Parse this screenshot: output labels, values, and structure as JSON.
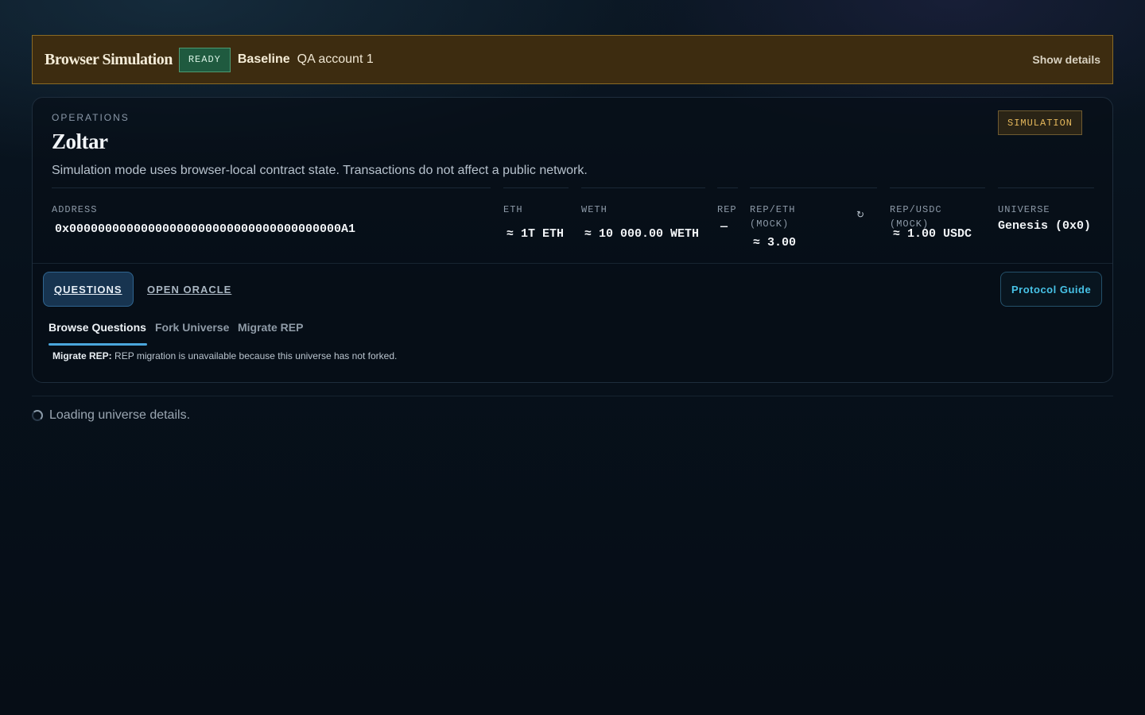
{
  "simulation_banner": {
    "title": "Browser Simulation",
    "status_badge": "READY",
    "scenario": "Baseline",
    "account": "QA account 1",
    "details_link": "Show details"
  },
  "header": {
    "eyebrow": "OPERATIONS",
    "title": "Zoltar",
    "mode_tag": "SIMULATION",
    "subtitle": "Simulation mode uses browser-local contract state. Transactions do not affect a public network."
  },
  "stats": {
    "address": {
      "label": "ADDRESS",
      "value": "0x00000000000000000000000000000000000000A1"
    },
    "eth": {
      "label": "ETH",
      "value": "≈ 1T ETH"
    },
    "weth": {
      "label": "WETH",
      "value": "≈ 10 000.00 WETH"
    },
    "rep": {
      "label": "REP",
      "value": "—"
    },
    "rep_eth": {
      "label_line1": "REP/ETH",
      "label_line2": "(MOCK)",
      "value": "≈ 3.00",
      "refresh_icon": "↻"
    },
    "rep_usdc": {
      "label": "REP/USDC (MOCK)",
      "value": "≈ 1.00 USDC"
    },
    "universe": {
      "label": "UNIVERSE",
      "value": "Genesis (0x0)"
    }
  },
  "tabs": {
    "main": [
      {
        "label": "QUESTIONS",
        "active": true
      },
      {
        "label": "OPEN ORACLE",
        "active": false
      }
    ],
    "protocol_guide": "Protocol Guide",
    "sub": [
      {
        "label": "Browse Questions",
        "active": true
      },
      {
        "label": "Fork Universe",
        "active": false
      },
      {
        "label": "Migrate REP",
        "active": false
      }
    ]
  },
  "notice": {
    "title": "Migrate REP:",
    "text": "REP migration is unavailable because this universe has not forked."
  },
  "loading": {
    "text": "Loading universe details."
  },
  "colors": {
    "banner_bg": "#3d2c10",
    "ready_badge": "#1f5a3f",
    "simulation_tag": "#e5b85c",
    "active_tab": "#173450",
    "accent": "#4aa6dc",
    "protocol_guide_text": "#47c2e6"
  }
}
